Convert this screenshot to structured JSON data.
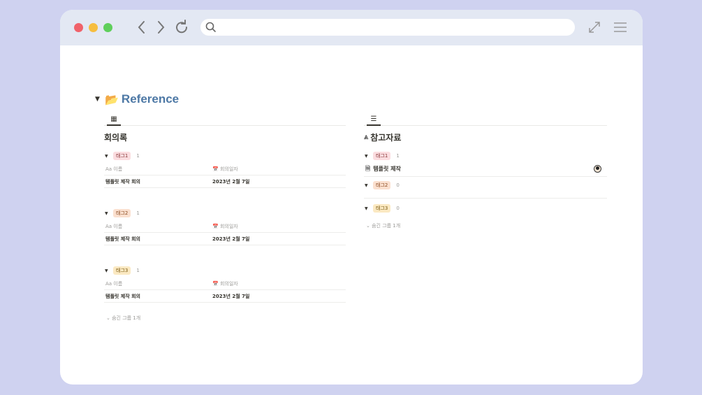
{
  "section": {
    "title": "Reference"
  },
  "left_db": {
    "title": "회의록",
    "groups": [
      {
        "tag": "태그1",
        "count": "1",
        "col_name": "Aa 이름",
        "col_date": "회의일자",
        "row_name": "템플릿 제작 회의",
        "row_date": "2023년 2월 7일"
      },
      {
        "tag": "태그2",
        "count": "1",
        "col_name": "Aa 이름",
        "col_date": "회의일자",
        "row_name": "템플릿 제작 회의",
        "row_date": "2023년 2월 7일"
      },
      {
        "tag": "태그3",
        "count": "1",
        "col_name": "Aa 이름",
        "col_date": "회의일자",
        "row_name": "템플릿 제작 회의",
        "row_date": "2023년 2월 7일"
      }
    ],
    "hidden": "숨긴 그룹 1개"
  },
  "right_db": {
    "title": "참고자료",
    "groups": [
      {
        "tag": "태그1",
        "count": "1",
        "item": "템플릿 제작"
      },
      {
        "tag": "태그2",
        "count": "0"
      },
      {
        "tag": "태그3",
        "count": "0"
      }
    ],
    "hidden": "숨긴 그룹 1개"
  },
  "colors": {
    "title": "#4d78a5",
    "background": "#cfd2f0",
    "titlebar": "#e3e8f3"
  }
}
